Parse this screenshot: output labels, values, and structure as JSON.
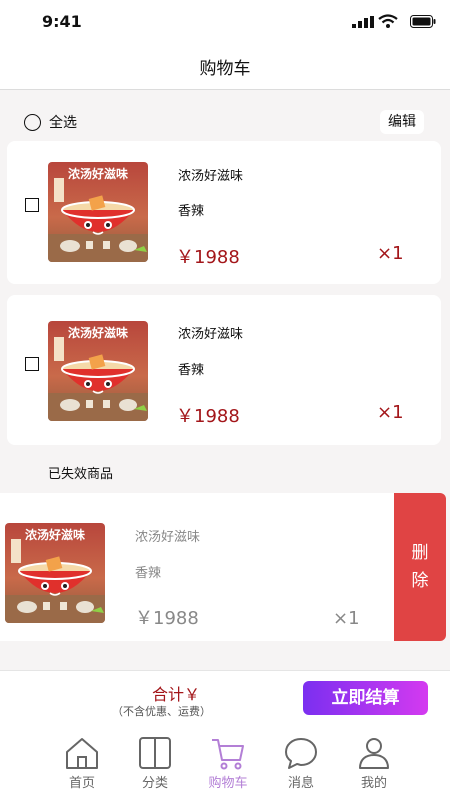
{
  "status": {
    "time": "9:41"
  },
  "header": {
    "title": "购物车"
  },
  "cart": {
    "select_all_label": "全选",
    "edit_label": "编辑",
    "items": [
      {
        "image_caption": "浓汤好滋味",
        "name": "浓汤好滋味",
        "spec": "香辣",
        "price": "￥1988",
        "qty": "×1"
      },
      {
        "image_caption": "浓汤好滋味",
        "name": "浓汤好滋味",
        "spec": "香辣",
        "price": "￥1988",
        "qty": "×1"
      }
    ],
    "invalid_title": "已失效商品",
    "invalid_item": {
      "image_caption": "浓汤好滋味",
      "name": "浓汤好滋味",
      "spec": "香辣",
      "price": "￥1988",
      "qty": "×1"
    },
    "delete_label_1": "删",
    "delete_label_2": "除"
  },
  "checkout": {
    "total_label": "合计￥",
    "note": "（不含优惠、运费）",
    "pay_label": "立即结算"
  },
  "tabs": [
    {
      "label": "首页",
      "icon": "home-icon"
    },
    {
      "label": "分类",
      "icon": "category-icon"
    },
    {
      "label": "购物车",
      "icon": "cart-icon",
      "active": true
    },
    {
      "label": "消息",
      "icon": "message-icon"
    },
    {
      "label": "我的",
      "icon": "user-icon"
    }
  ],
  "colors": {
    "price": "#a3161a",
    "delete": "#e04444",
    "pay_start": "#7b2ff0",
    "pay_end": "#d43af0",
    "tab_active": "#b37fd6"
  }
}
